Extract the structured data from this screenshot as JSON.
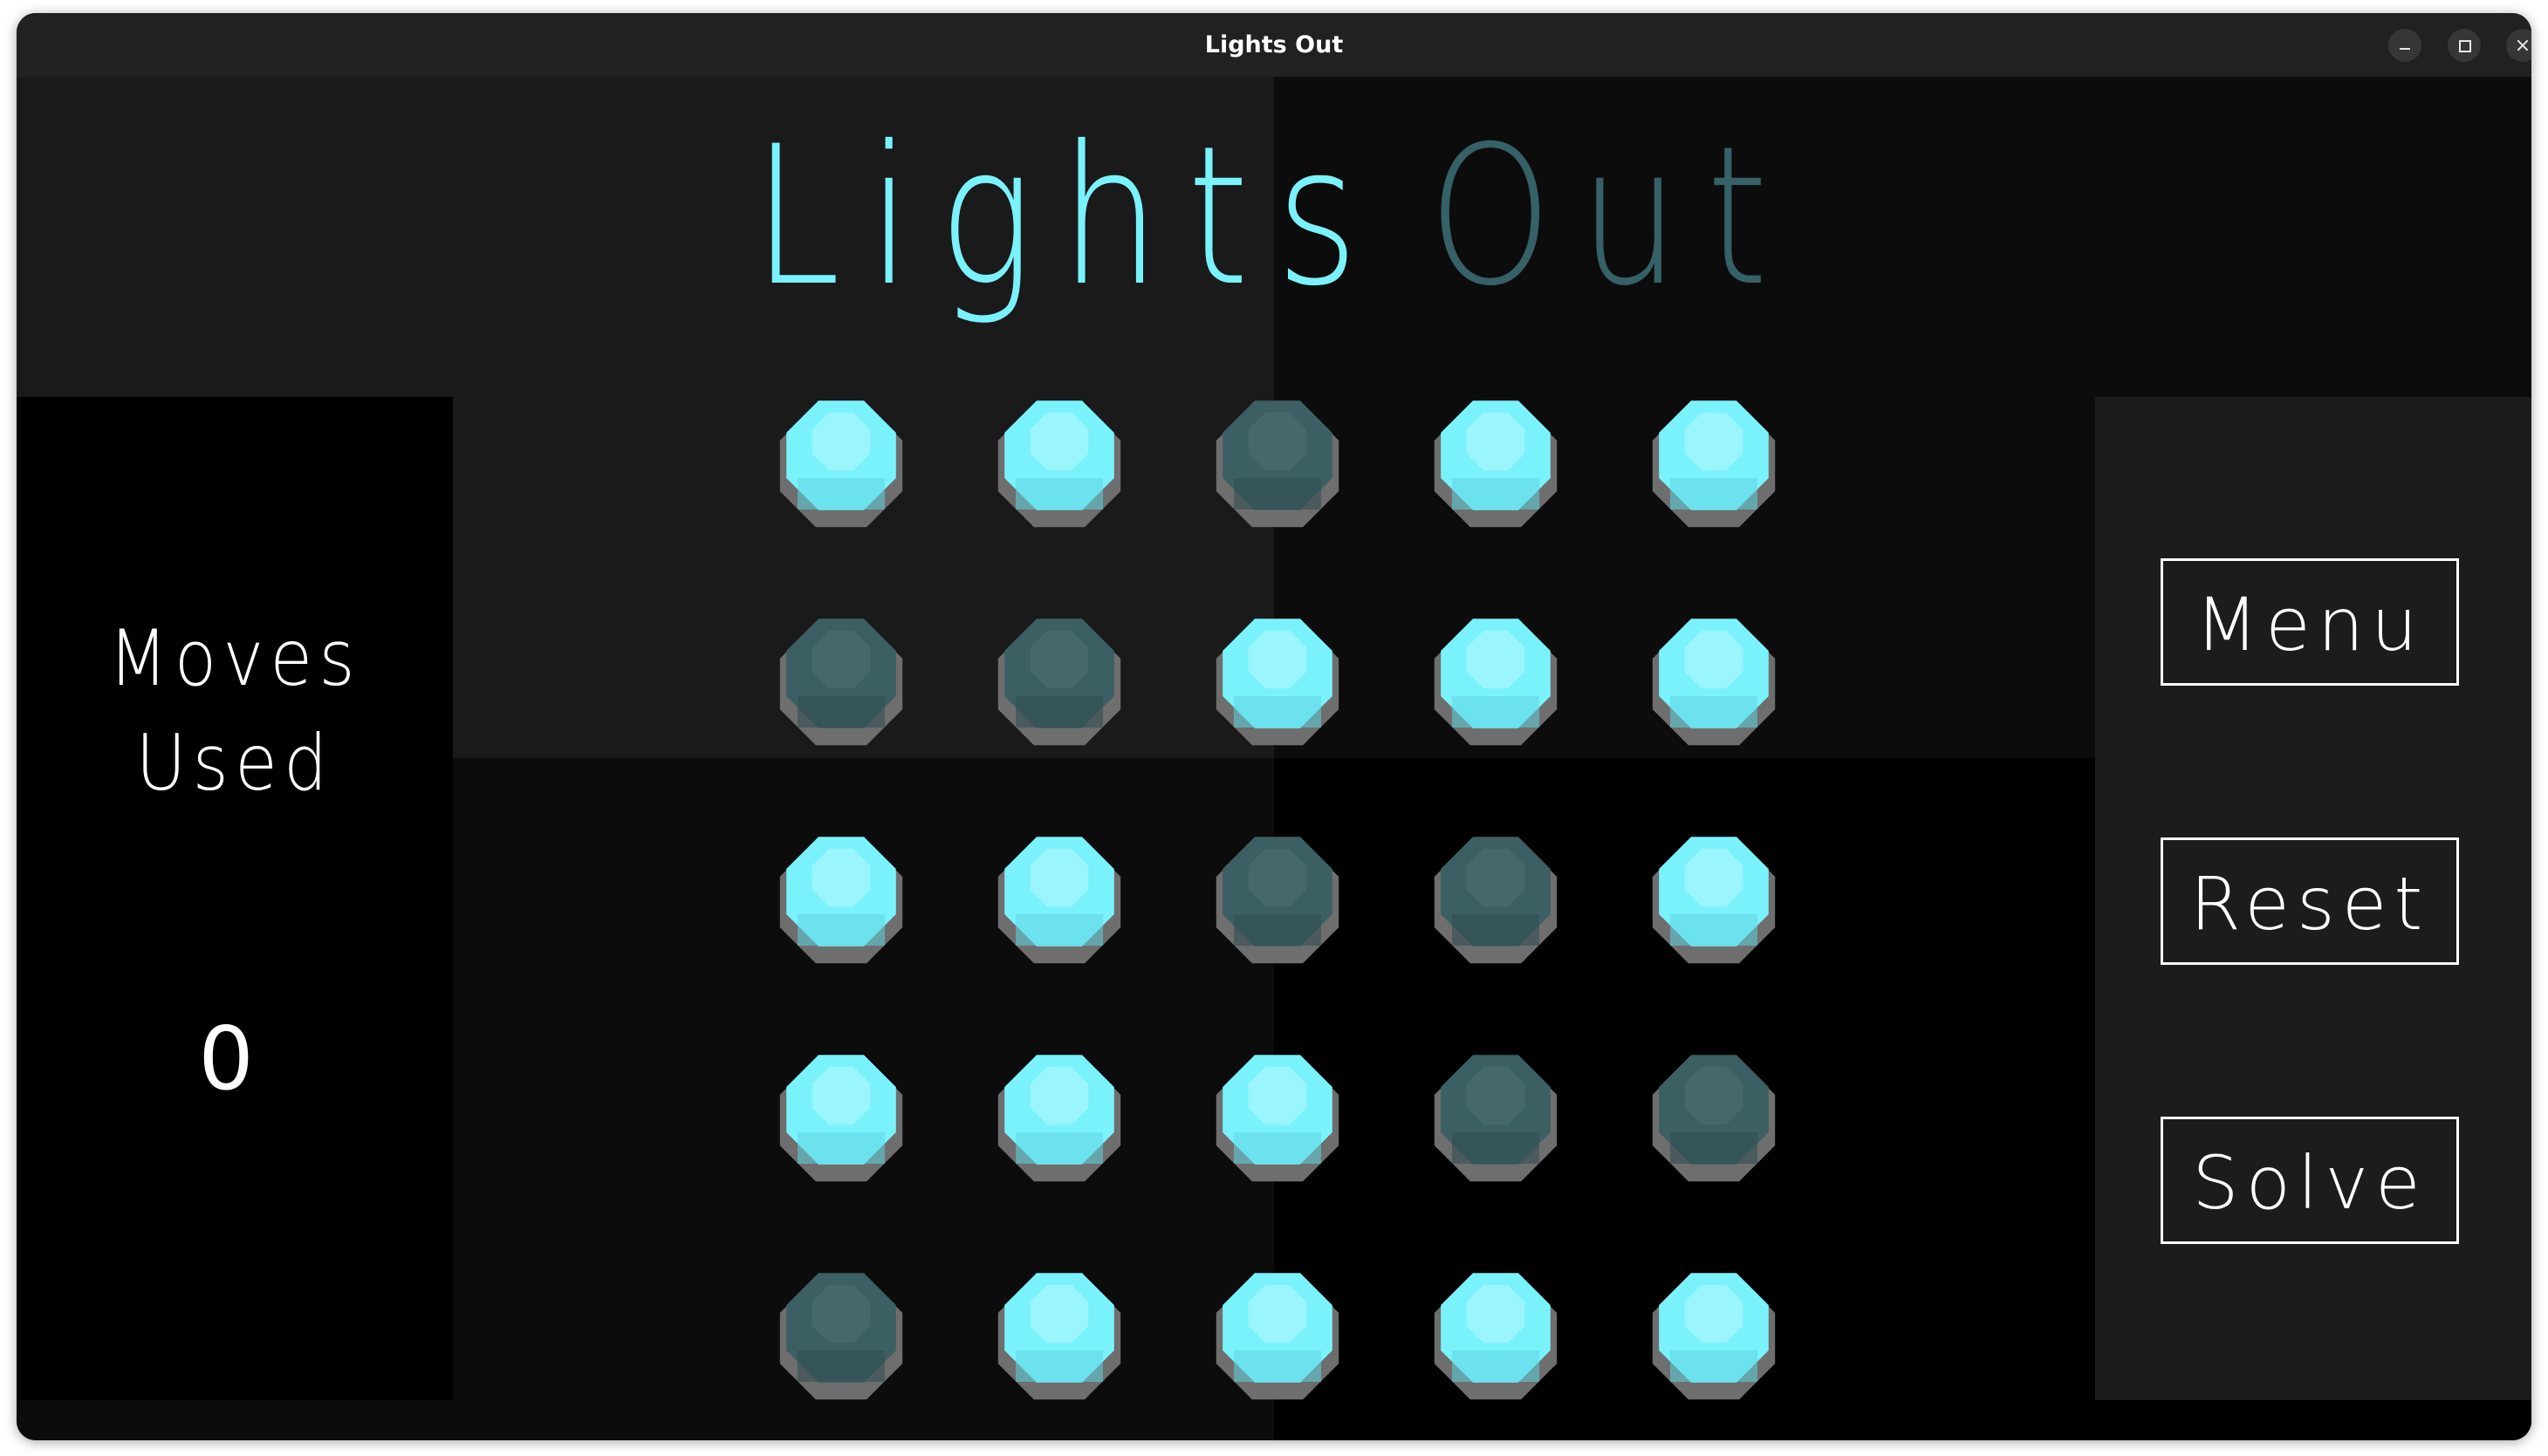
{
  "window": {
    "title": "Lights Out"
  },
  "heading": {
    "word1": "Lights",
    "word2": "Out"
  },
  "stats": {
    "moves_label_line1": "Moves",
    "moves_label_line2": "Used",
    "moves_count": "0"
  },
  "buttons": {
    "menu": "Menu",
    "reset": "Reset",
    "solve": "Solve"
  },
  "colors": {
    "on_light": "#7af2fc",
    "off_light": "#3c5f63",
    "rim": "#6e6e6e",
    "title_lit": "#7af2fc",
    "title_dim": "#356167"
  },
  "board": {
    "rows": 5,
    "cols": 5,
    "grid": [
      [
        1,
        1,
        0,
        1,
        1
      ],
      [
        0,
        0,
        1,
        1,
        1
      ],
      [
        1,
        1,
        0,
        0,
        1
      ],
      [
        1,
        1,
        1,
        0,
        0
      ],
      [
        0,
        1,
        1,
        1,
        1
      ]
    ]
  }
}
